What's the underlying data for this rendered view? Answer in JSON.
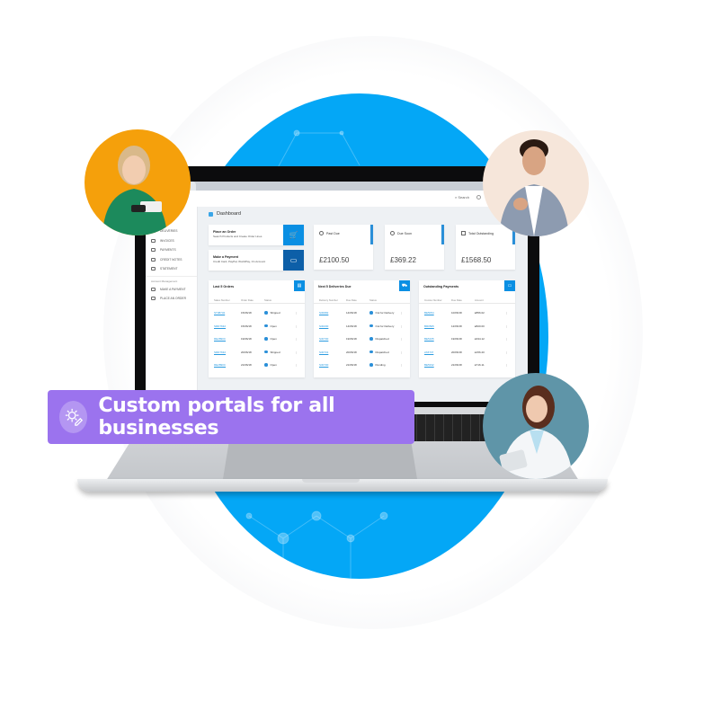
{
  "banner": {
    "text": "Custom portals for all businesses",
    "icon": "gear-pencil-icon",
    "color": "#9b73ee"
  },
  "colors": {
    "accent_blue": "#04a7f6",
    "button_blue": "#0a8fe3",
    "button_dark_blue": "#0d5fa8"
  },
  "portal": {
    "topbar": {
      "search_label": "Search"
    },
    "sidebar": {
      "items": [
        {
          "label": "Deliveries",
          "icon": "truck-icon"
        },
        {
          "label": "Invoices",
          "icon": "invoice-icon"
        },
        {
          "label": "Payments",
          "icon": "payment-icon"
        },
        {
          "label": "Credit Notes",
          "icon": "credit-note-icon"
        },
        {
          "label": "Statement",
          "icon": "statement-icon"
        }
      ],
      "section_label": "Account Management",
      "section_items": [
        {
          "label": "Make a Payment",
          "icon": "card-icon"
        },
        {
          "label": "Place an Order",
          "icon": "cart-icon"
        }
      ]
    },
    "page_title": "Dashboard",
    "actions": [
      {
        "title": "Place an Order",
        "subtitle": "Search Products and Create Order Lines",
        "icon": "cart-add-icon"
      },
      {
        "title": "Make a Payment",
        "subtitle": "Credit Card, PayPal, WorldPay, On Account",
        "icon": "card-add-icon"
      }
    ],
    "stats": [
      {
        "label": "Past Due",
        "value": "£2100.50",
        "icon": "alert-icon"
      },
      {
        "label": "Due Soon",
        "value": "£369.22",
        "icon": "clock-icon"
      },
      {
        "label": "Total Outstanding",
        "value": "£1568.50",
        "icon": "flag-icon"
      }
    ],
    "tables": [
      {
        "title": "Last 5 Orders",
        "columns": [
          "Sales Number",
          "Order Date",
          "Status"
        ],
        "rows": [
          [
            "ST08732",
            "15/06/18",
            "Shipped"
          ],
          [
            "SRD7632",
            "15/06/18",
            "Open"
          ],
          [
            "RE2890C",
            "19/06/18",
            "Open"
          ],
          [
            "SRD7632",
            "20/06/18",
            "Shipped"
          ],
          [
            "RE2890C",
            "21/06/18",
            "Open"
          ]
        ]
      },
      {
        "title": "Next 5 Deliveries Due",
        "columns": [
          "Delivery Number",
          "Due Date",
          "Status"
        ],
        "rows": [
          [
            "S30082",
            "14/06/18",
            "Out for Delivery"
          ],
          [
            "S30230",
            "14/06/18",
            "Out for Delivery"
          ],
          [
            "S30730",
            "19/06/18",
            "Dispatched"
          ],
          [
            "S30731",
            "20/06/18",
            "Dispatched"
          ],
          [
            "S30730",
            "21/06/18",
            "Pending"
          ]
        ]
      },
      {
        "title": "Outstanding Payments",
        "columns": [
          "Invoice Number",
          "Due Date",
          "Amount"
        ],
        "rows": [
          [
            "BE5054",
            "10/06/18",
            "£856.02"
          ],
          [
            "BR0505",
            "12/06/18",
            "£820.00"
          ],
          [
            "BE5165",
            "19/06/18",
            "£334.12"
          ],
          [
            "2A5737",
            "20/06/18",
            "£156.20"
          ],
          [
            "BE5332",
            "21/06/18",
            "£716.11"
          ]
        ]
      }
    ]
  },
  "avatars": [
    {
      "label": "woman-with-phone-and-card"
    },
    {
      "label": "man-with-headset"
    },
    {
      "label": "doctor-with-tablet"
    }
  ]
}
